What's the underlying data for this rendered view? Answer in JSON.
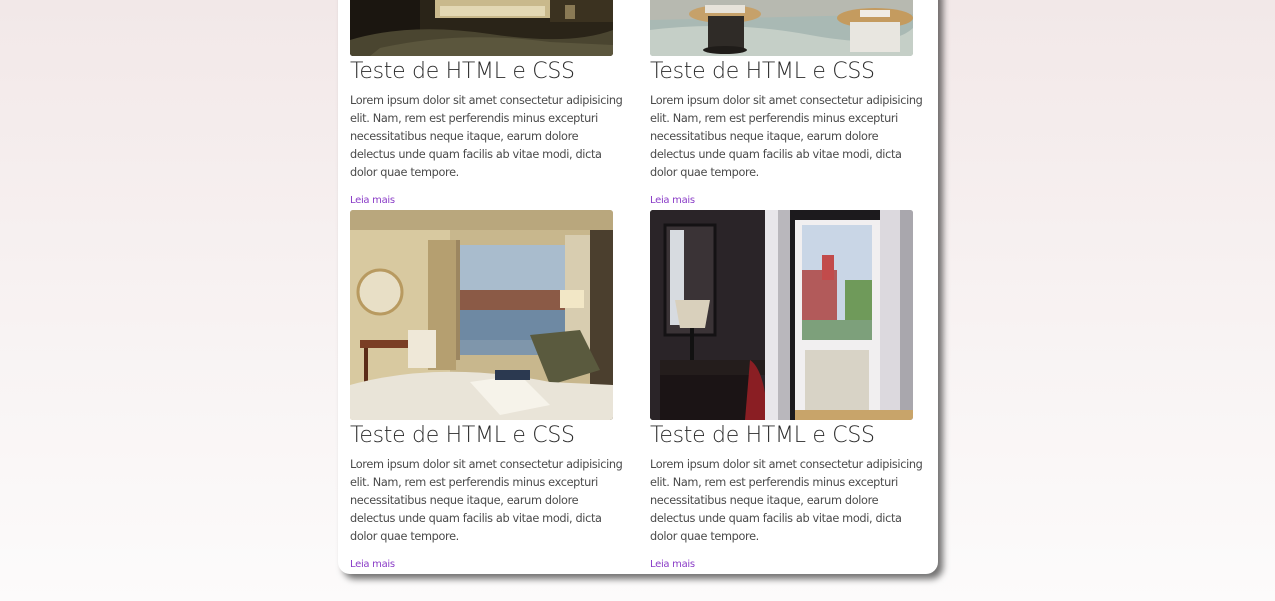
{
  "posts": [
    {
      "title": "Teste de HTML e CSS",
      "text": "Lorem ipsum dolor sit amet consectetur adipisicing elit. Nam, rem est perferendis minus excepturi necessitatibus neque itaque, earum dolore delectus unde quam facilis ab vitae modi, dicta dolor quae tempore.",
      "link": "Leia mais"
    },
    {
      "title": "Teste de HTML e CSS",
      "text": "Lorem ipsum dolor sit amet consectetur adipisicing elit. Nam, rem est perferendis minus excepturi necessitatibus neque itaque, earum dolore delectus unde quam facilis ab vitae modi, dicta dolor quae tempore.",
      "link": "Leia mais"
    },
    {
      "title": "Teste de HTML e CSS",
      "text": "Lorem ipsum dolor sit amet consectetur adipisicing elit. Nam, rem est perferendis minus excepturi necessitatibus neque itaque, earum dolore delectus unde quam facilis ab vitae modi, dicta dolor quae tempore.",
      "link": "Leia mais"
    },
    {
      "title": "Teste de HTML e CSS",
      "text": "Lorem ipsum dolor sit amet consectetur adipisicing elit. Nam, rem est perferendis minus excepturi necessitatibus neque itaque, earum dolore delectus unde quam facilis ab vitae modi, dicta dolor quae tempore.",
      "link": "Leia mais"
    }
  ],
  "colors": {
    "link": "#8a3cc7",
    "title": "#2b2b2b",
    "text": "#4a4a4a",
    "card": "#ffffff"
  }
}
